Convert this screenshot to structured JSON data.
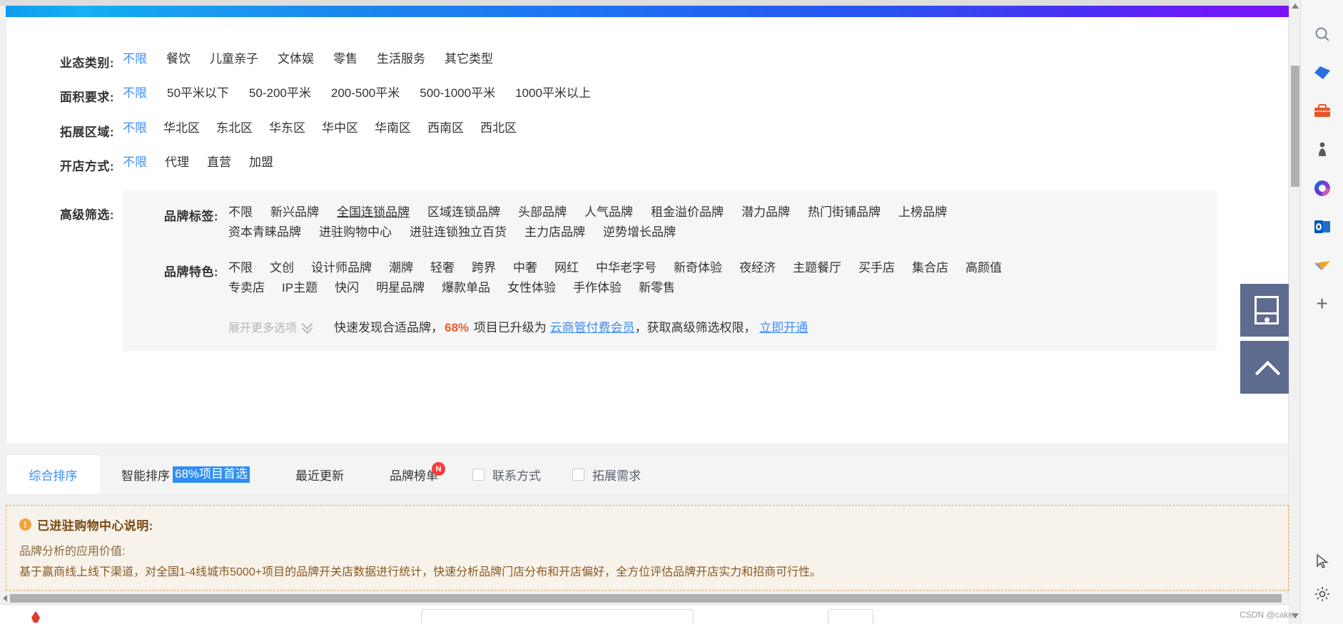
{
  "filters": [
    {
      "label": "业态类别:",
      "options": [
        "不限",
        "餐饮",
        "儿童亲子",
        "文体娱",
        "零售",
        "生活服务",
        "其它类型"
      ],
      "active_index": 0
    },
    {
      "label": "面积要求:",
      "options": [
        "不限",
        "50平米以下",
        "50-200平米",
        "200-500平米",
        "500-1000平米",
        "1000平米以上"
      ],
      "active_index": 0
    },
    {
      "label": "拓展区域:",
      "options": [
        "不限",
        "华北区",
        "东北区",
        "华东区",
        "华中区",
        "华南区",
        "西南区",
        "西北区"
      ],
      "active_index": 0
    },
    {
      "label": "开店方式:",
      "options": [
        "不限",
        "代理",
        "直营",
        "加盟"
      ],
      "active_index": 0
    }
  ],
  "advanced": {
    "label": "高级筛选:",
    "brand_tags": {
      "label": "品牌标签:",
      "options": [
        "不限",
        "新兴品牌",
        "全国连锁品牌",
        "区域连锁品牌",
        "头部品牌",
        "人气品牌",
        "租金溢价品牌",
        "潜力品牌",
        "热门街铺品牌",
        "上榜品牌",
        "资本青睐品牌",
        "进驻购物中心",
        "进驻连锁独立百货",
        "主力店品牌",
        "逆势增长品牌"
      ],
      "active_index": 0,
      "hovered_index": 2
    },
    "brand_features": {
      "label": "品牌特色:",
      "options": [
        "不限",
        "文创",
        "设计师品牌",
        "潮牌",
        "轻奢",
        "跨界",
        "中奢",
        "网红",
        "中华老字号",
        "新奇体验",
        "夜经济",
        "主题餐厅",
        "买手店",
        "集合店",
        "高颜值",
        "专卖店",
        "IP主题",
        "快闪",
        "明星品牌",
        "爆款单品",
        "女性体验",
        "手作体验",
        "新零售"
      ],
      "active_index": 0
    },
    "expand_more": "展开更多选项",
    "promo": {
      "prefix": "快速发现合适品牌，",
      "percent": "68%",
      "middle": "项目已升级为",
      "link1": "云商管付费会员",
      "middle2": "，获取高级筛选权限，",
      "link2": "立即开通"
    }
  },
  "sort_bar": {
    "tabs": [
      {
        "label": "综合排序",
        "active": true
      },
      {
        "label": "智能排序",
        "badge": "68%项目首选",
        "active": false
      },
      {
        "label": "最近更新",
        "active": false
      },
      {
        "label": "品牌榜单",
        "corner_badge": "N",
        "active": false
      }
    ],
    "checkboxes": [
      {
        "label": "联系方式",
        "checked": false
      },
      {
        "label": "拓展需求",
        "checked": false
      }
    ]
  },
  "notice": {
    "icon": "!",
    "title": "已进驻购物中心说明:",
    "subtitle": "品牌分析的应用价值:",
    "body": "基于赢商线上线下渠道，对全国1-4线城市5000+项目的品牌开关店数据进行统计，快速分析品牌门店分布和开店偏好，全方位评估品牌开店实力和招商可行性。"
  },
  "float_buttons": [
    {
      "name": "qr-code",
      "label": "二维码"
    },
    {
      "name": "back-to-top",
      "label": "返回顶部"
    }
  ],
  "app_sidebar": {
    "icons": [
      "search-icon",
      "copilot-icon",
      "shopping-icon",
      "games-icon",
      "microsoft-365-icon",
      "outlook-icon",
      "edge-drop-icon",
      "add-icon"
    ],
    "bottom_icons": [
      "cursor-icon",
      "settings-icon"
    ]
  },
  "watermark": "CSDN @caker"
}
